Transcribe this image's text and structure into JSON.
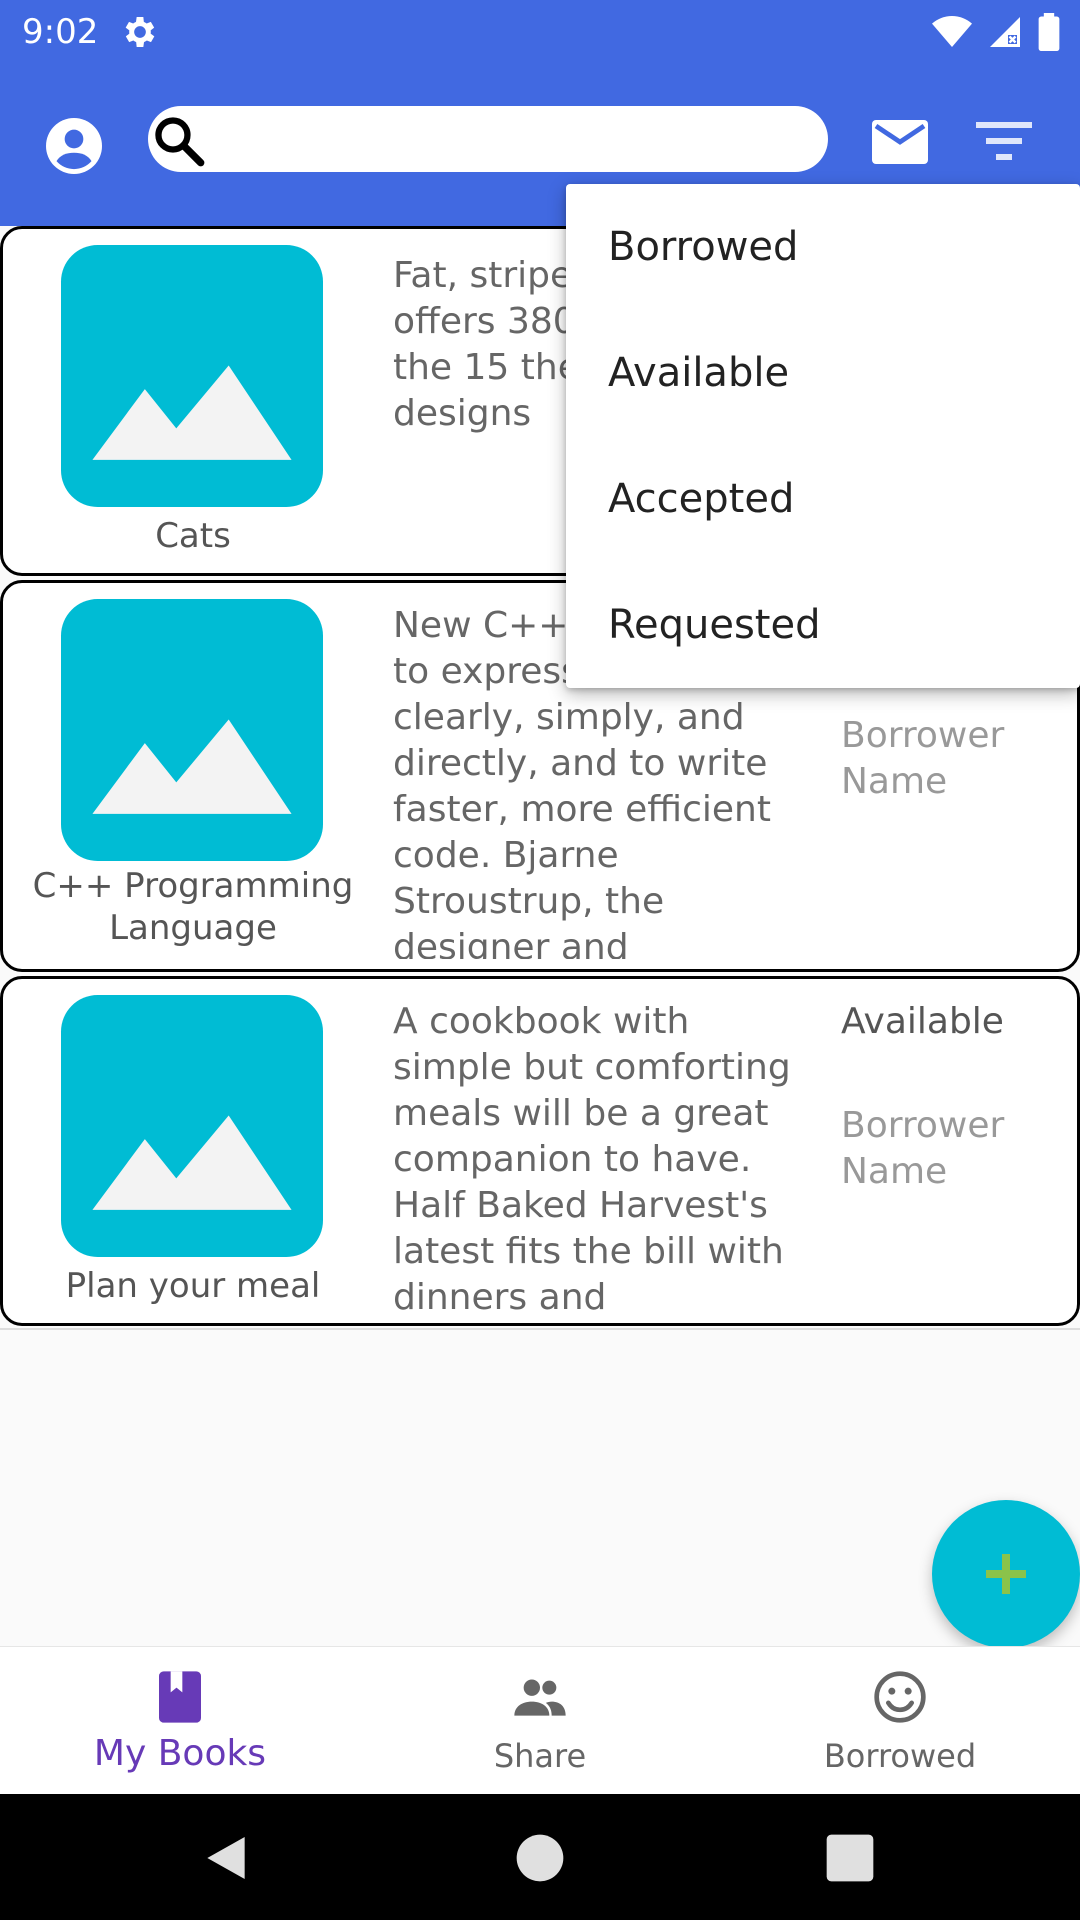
{
  "status_bar": {
    "time": "9:02",
    "icons": [
      "gear-icon",
      "wifi-icon",
      "signal-icon",
      "battery-icon"
    ]
  },
  "app_bar": {
    "search": {
      "value": "",
      "placeholder": ""
    },
    "icons": [
      "profile-icon",
      "search-icon",
      "mail-icon",
      "filter-icon"
    ]
  },
  "dropdown": {
    "items": [
      "Borrowed",
      "Available",
      "Accepted",
      "Requested"
    ]
  },
  "books": [
    {
      "title": "Cats",
      "description": "Fat, striped or grumpy offers 380 for cat lov the 15 the sets offers designs",
      "status": "",
      "borrower": ""
    },
    {
      "title": "C++ Programming Language",
      "description": "New C++1 allows prog to express ideas more clearly, simply, and directly, and to write faster, more efficient code. Bjarne Stroustrup, the designer and",
      "status": "",
      "borrower": "Borrower Name"
    },
    {
      "title": "Plan your meal",
      "description": "A cookbook with simple but comforting meals will be a great companion to have. Half Baked Harvest's latest fits the bill with dinners and",
      "status": "Available",
      "borrower": "Borrower Name"
    }
  ],
  "bottom_nav": {
    "items": [
      {
        "label": "My Books",
        "icon": "book-icon",
        "active": true
      },
      {
        "label": "Share",
        "icon": "people-icon",
        "active": false
      },
      {
        "label": "Borrowed",
        "icon": "smiley-icon",
        "active": false
      }
    ]
  },
  "colors": {
    "primary": "#4169e1",
    "accent": "#00bcd4",
    "nav_active": "#673ab7",
    "fab_plus": "#8bc34a"
  }
}
